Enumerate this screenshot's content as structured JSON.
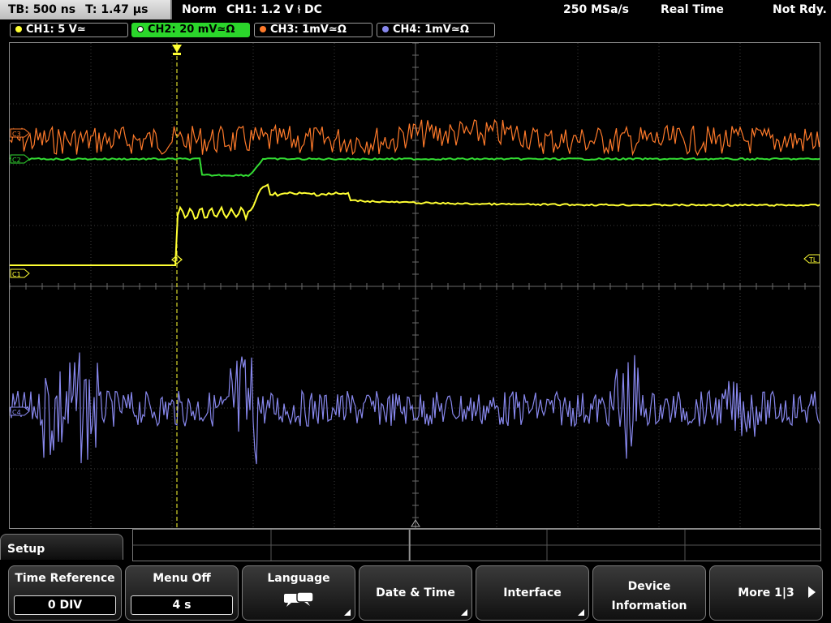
{
  "status": {
    "timebase": "TB: 500 ns",
    "trigger_time": "T: 1.47 µs",
    "mode": "Norm",
    "trigger_info": "CH1: 1.2 V ⫮ DC",
    "sample_rate": "250 MSa/s",
    "acq_mode": "Real Time",
    "state": "Not Rdy."
  },
  "channels": [
    {
      "id": "ch1",
      "label": "CH1: 5 V≃",
      "color": "#ffff33",
      "active": false
    },
    {
      "id": "ch2",
      "label": "CH2: 20 mV≃Ω",
      "color": "#33dd33",
      "active": true
    },
    {
      "id": "ch3",
      "label": "CH3: 1mV≃Ω",
      "color": "#ff7a2a",
      "active": false
    },
    {
      "id": "ch4",
      "label": "CH4: 1mV≃Ω",
      "color": "#8888ee",
      "active": false
    }
  ],
  "markers": {
    "ch3": "C3",
    "ch2": "C2",
    "ch1": "C1",
    "ch4": "C4",
    "trigger_level": "TL"
  },
  "menu": {
    "title": "Setup",
    "softkeys": [
      {
        "label": "Time Reference",
        "value": "0 DIV"
      },
      {
        "label": "Menu Off",
        "value": "4 s"
      },
      {
        "label": "Language",
        "icon": "language-speech-icon"
      },
      {
        "label": "Date & Time"
      },
      {
        "label": "Interface"
      },
      {
        "label": "Device\nInformation"
      },
      {
        "label": "More 1|3"
      }
    ]
  }
}
